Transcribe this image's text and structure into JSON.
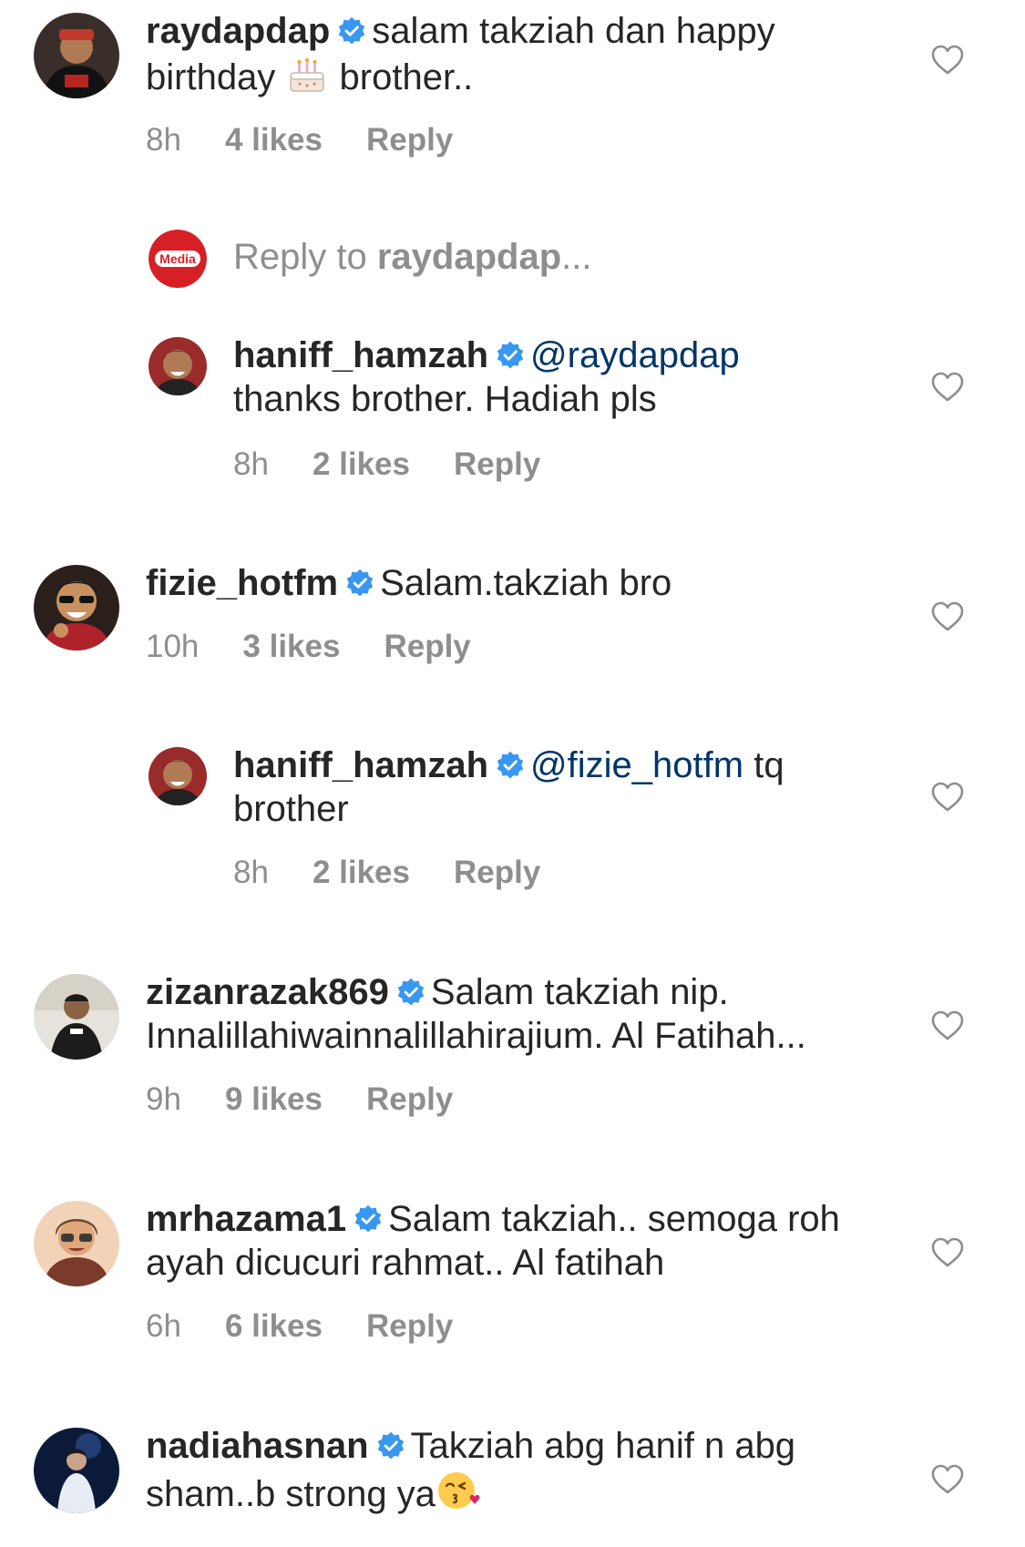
{
  "colors": {
    "text": "#262626",
    "secondary": "#8e8e8e",
    "mention": "#003569",
    "verified": "#3897f0"
  },
  "comments": [
    {
      "username": "raydapdap",
      "text_before": "salam takziah dan happy birthday ",
      "emoji": "birthday-cake",
      "text_after": " brother..",
      "time": "8h",
      "likes": "4 likes",
      "reply": "Reply"
    },
    {
      "username": "fizie_hotfm",
      "text": "Salam.takziah bro",
      "time": "10h",
      "likes": "3 likes",
      "reply": "Reply"
    },
    {
      "username": "zizanrazak869",
      "text": "Salam takziah nip. Innalillahiwainnalillahirajium. Al Fatihah...",
      "time": "9h",
      "likes": "9 likes",
      "reply": "Reply"
    },
    {
      "username": "mrhazama1",
      "text": "Salam takziah.. semoga roh ayah dicucuri rahmat.. Al fatihah",
      "time": "6h",
      "likes": "6 likes",
      "reply": "Reply"
    },
    {
      "username": "nadiahasnan",
      "text": "Takziah abg hanif n abg sham..b strong ya",
      "emoji": "face-blowing-kiss"
    }
  ],
  "replies": [
    {
      "username": "haniff_hamzah",
      "mention": "@raydapdap",
      "text": "thanks brother. Hadiah pls",
      "time": "8h",
      "likes": "2 likes",
      "reply": "Reply"
    },
    {
      "username": "haniff_hamzah",
      "mention": "@fizie_hotfm",
      "text": "tq brother",
      "time": "8h",
      "likes": "2 likes",
      "reply": "Reply"
    }
  ],
  "reply_input": {
    "prefix": "Reply to ",
    "target": "raydapdap",
    "suffix": "..."
  },
  "icons": {
    "verified": "verified-badge-icon",
    "like": "heart-outline-icon"
  },
  "avatar_labels": {
    "media": "Media"
  }
}
